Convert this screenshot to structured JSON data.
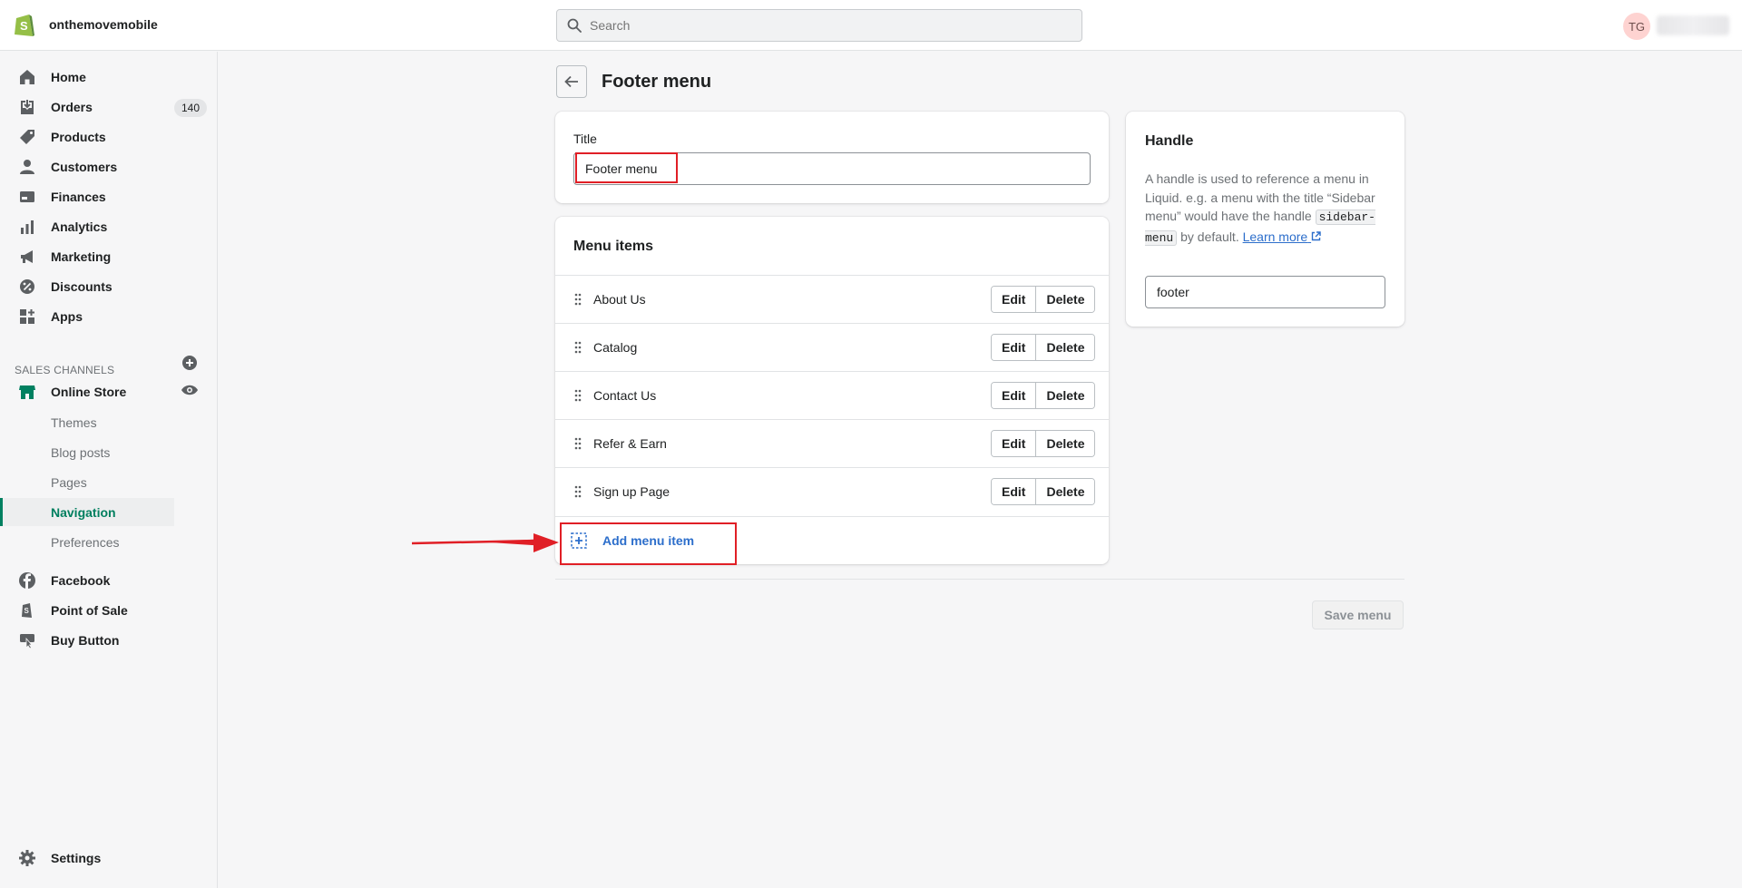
{
  "topbar": {
    "store_name": "onthemovemobile",
    "search_placeholder": "Search",
    "avatar_initials": "TG"
  },
  "sidebar": {
    "items": [
      {
        "label": "Home",
        "icon": "home-icon"
      },
      {
        "label": "Orders",
        "icon": "orders-icon",
        "badge": "140"
      },
      {
        "label": "Products",
        "icon": "tag-icon"
      },
      {
        "label": "Customers",
        "icon": "person-icon"
      },
      {
        "label": "Finances",
        "icon": "finances-icon"
      },
      {
        "label": "Analytics",
        "icon": "bar-chart-icon"
      },
      {
        "label": "Marketing",
        "icon": "megaphone-icon"
      },
      {
        "label": "Discounts",
        "icon": "discount-icon"
      },
      {
        "label": "Apps",
        "icon": "apps-icon"
      }
    ],
    "sales_channels_heading": "Sales channels",
    "online_store": "Online Store",
    "sub_items": [
      "Themes",
      "Blog posts",
      "Pages",
      "Navigation",
      "Preferences"
    ],
    "channels": [
      {
        "label": "Facebook",
        "icon": "facebook-icon"
      },
      {
        "label": "Point of Sale",
        "icon": "pos-icon"
      },
      {
        "label": "Buy Button",
        "icon": "buy-button-icon"
      }
    ],
    "settings": "Settings"
  },
  "page": {
    "title": "Footer menu"
  },
  "title_card": {
    "label": "Title",
    "value": "Footer menu"
  },
  "menu_card": {
    "heading": "Menu items",
    "items": [
      "About Us",
      "Catalog",
      "Contact Us",
      "Refer & Earn",
      "Sign up Page"
    ],
    "edit_label": "Edit",
    "delete_label": "Delete",
    "add_label": "Add menu item"
  },
  "handle_card": {
    "heading": "Handle",
    "help_before": "A handle is used to reference a menu in Liquid. e.g. a menu with the title “Sidebar menu” would have the handle",
    "help_code": "sidebar-menu",
    "help_after": "by default.",
    "learn_more": "Learn more",
    "value": "footer"
  },
  "footer": {
    "save_label": "Save menu"
  },
  "colors": {
    "accent_green": "#008060",
    "link_blue": "#2c6ecb",
    "annotation_red": "#e01f26"
  }
}
